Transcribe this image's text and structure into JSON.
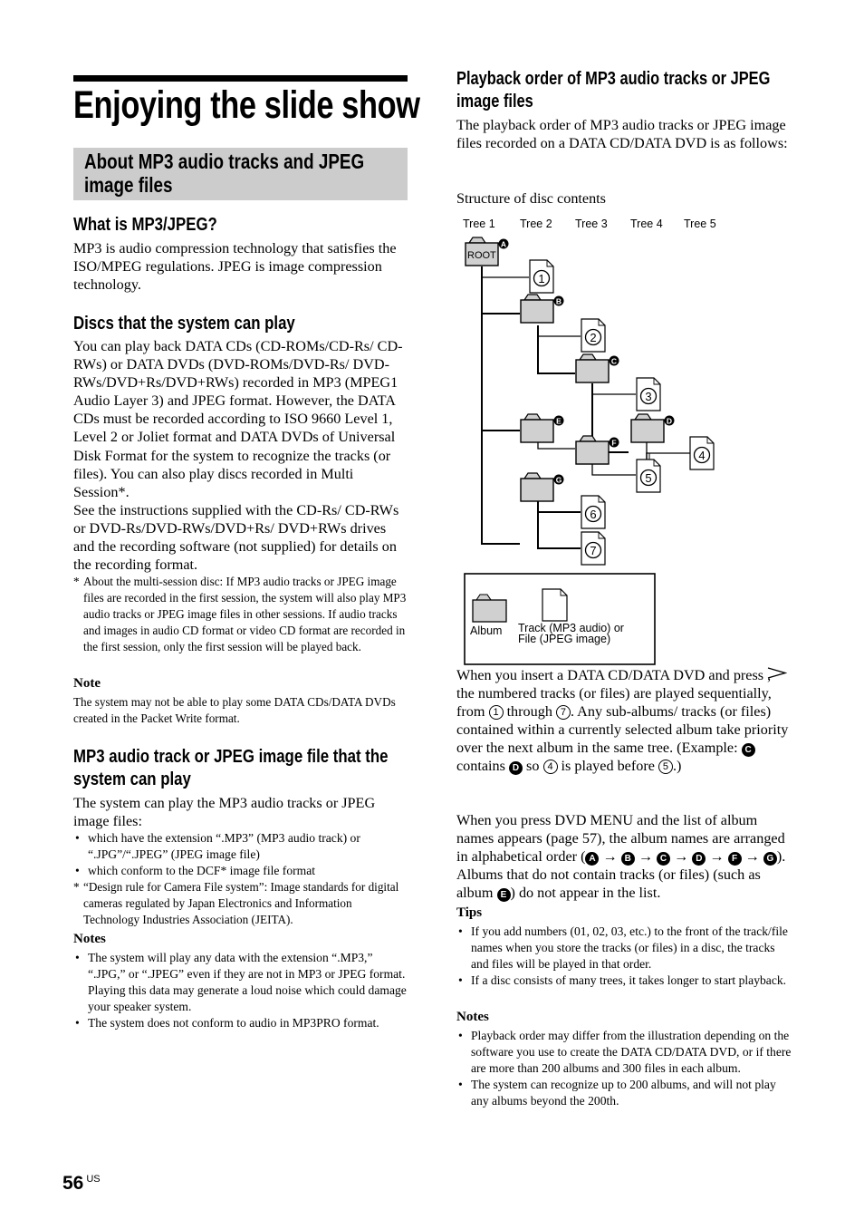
{
  "page": {
    "title": "Enjoying the slide show",
    "section_title_line1": "About MP3 audio tracks and JPEG",
    "section_title_line2": "image files",
    "page_number": "56",
    "page_region": "US"
  },
  "left": {
    "what_is": {
      "heading": "What is MP3/JPEG?",
      "body": "MP3 is audio compression technology that satisfies the ISO/MPEG regulations. JPEG is image compression technology."
    },
    "discs": {
      "heading": "Discs that the system can play",
      "body1": "You can play back DATA CDs (CD-ROMs/CD-Rs/ CD-RWs) or DATA DVDs (DVD-ROMs/DVD-Rs/ DVD-RWs/DVD+Rs/DVD+RWs) recorded in MP3 (MPEG1 Audio Layer 3) and JPEG format. However, the DATA CDs must be recorded according to ISO 9660 Level 1, Level 2 or Joliet format and DATA DVDs of Universal Disk Format for the system to recognize the tracks (or files). You can also play discs recorded in Multi Session*.",
      "body2": "See the instructions supplied with the CD-Rs/ CD-RWs or DVD-Rs/DVD-RWs/DVD+Rs/ DVD+RWs drives and the recording software (not supplied) for details on the recording format.",
      "footnote": "About the multi-session disc: If MP3 audio tracks or JPEG image files are recorded in the first session, the system will also play MP3 audio tracks or JPEG image files in other sessions. If audio tracks and images in audio CD format or video CD format are recorded in the first session, only the first session will be played back.",
      "note_heading": "Note",
      "note": "The system may not be able to play some DATA CDs/DATA DVDs created in the Packet Write format."
    },
    "files": {
      "heading_line1": "MP3 audio track or JPEG image file that the",
      "heading_line2": "system can play",
      "intro": "The system can play the MP3 audio tracks or JPEG image files:",
      "bullets": [
        "which have the extension “.MP3” (MP3 audio track) or “.JPG”/“.JPEG” (JPEG image file)",
        "which conform to the DCF* image file format"
      ],
      "footnote": "“Design rule for Camera File system”: Image standards for digital cameras regulated by Japan Electronics and Information Technology Industries Association (JEITA).",
      "notes_heading": "Notes",
      "notes": [
        "The system will play any data with the extension “.MP3,” “.JPG,” or “.JPEG” even if they are not in MP3 or JPEG format. Playing this data may generate a loud noise which could damage your speaker system.",
        "The system does not conform to audio in MP3PRO format."
      ]
    }
  },
  "right": {
    "heading_line1": "Playback order of MP3 audio tracks or JPEG",
    "heading_line2": "image files",
    "intro": "The playback order of MP3 audio tracks or JPEG image files recorded on a DATA CD/DATA DVD is as follows:",
    "structure_label": "Structure of disc contents",
    "diagram": {
      "tree_labels": [
        "Tree 1",
        "Tree 2",
        "Tree 3",
        "Tree 4",
        "Tree 5"
      ],
      "root_label": "ROOT",
      "albums": [
        "A",
        "B",
        "C",
        "D",
        "E",
        "F",
        "G"
      ],
      "tracks": [
        "1",
        "2",
        "3",
        "4",
        "5",
        "6",
        "7"
      ],
      "legend_album": "Album",
      "legend_track_line1": "Track (MP3 audio) or",
      "legend_track_line2": "File (JPEG image)"
    },
    "para1": {
      "t1": "When you insert a DATA CD/DATA DVD and press",
      "t2": ", the numbered tracks (or files) are played sequentially, from",
      "n1": "1",
      "t3": "through",
      "n2": "7",
      "t4": ". Any sub-albums/ tracks (or files) contained within a currently selected album take priority over the next album in the same tree. (Example:",
      "l1": "C",
      "t5": "contains",
      "l2": "D",
      "t6": "so",
      "n3": "4",
      "t7": "is played before",
      "n4": "5",
      "t8": ".)"
    },
    "para2": {
      "t1": "When you press DVD MENU and the list of album names appears (page 57), the album names are arranged in alphabetical order (",
      "order": [
        "A",
        "B",
        "C",
        "D",
        "F",
        "G"
      ],
      "arrow": "→",
      "t2": "). Albums that do not contain tracks (or files) (such as album",
      "l_excluded": "E",
      "t3": ") do not appear in the list."
    },
    "tips_heading": "Tips",
    "tips": [
      "If you add numbers (01, 02, 03, etc.) to the front of the track/file names when you store the tracks (or files) in a disc, the tracks and files will be played in that order.",
      "If a disc consists of many trees, it takes longer to start playback."
    ],
    "notes_heading": "Notes",
    "notes": [
      "Playback order may differ from the illustration depending on the software you use to create the DATA CD/DATA DVD, or if there are more than 200 albums and 300 files in each album.",
      "The system can recognize up to 200 albums, and will not play any albums beyond the 200th."
    ]
  }
}
